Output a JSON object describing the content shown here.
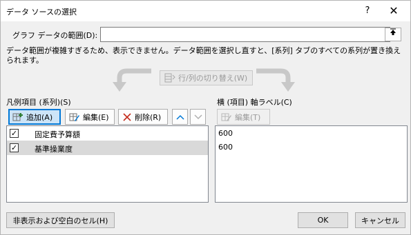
{
  "window": {
    "title": "データ ソースの選択",
    "help": "?",
    "close": "✕"
  },
  "range": {
    "label": "グラフ データの範囲(D):",
    "value": ""
  },
  "warning": "データ範囲が複雑すぎるため、表示できません。データ範囲を選択し直すと、[系列] タブのすべての系列が置き換えられます。",
  "switch_button": "行/列の切り替え(W)",
  "legend": {
    "label": "凡例項目 (系列)(S)",
    "add": "追加(A)",
    "edit": "編集(E)",
    "delete": "削除(R)",
    "items": [
      {
        "label": "固定費予算額",
        "checked": true
      },
      {
        "label": "基準操業度",
        "checked": true
      }
    ]
  },
  "axis": {
    "label": "横 (項目) 軸ラベル(C)",
    "edit": "編集(T)",
    "items": [
      "600",
      "600"
    ]
  },
  "buttons": {
    "hidden_cells": "非表示および空白のセル(H)",
    "ok": "OK",
    "cancel": "キャンセル"
  },
  "colors": {
    "selected_button": "#cce4f7",
    "accent": "#0078d7",
    "delete_icon": "#c42b1c",
    "add_icon": "#2e7d32"
  }
}
